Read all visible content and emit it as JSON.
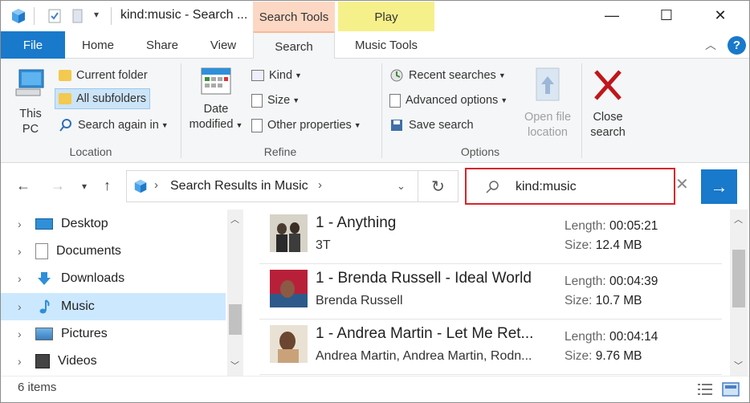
{
  "window": {
    "title": "kind:music - Search ...",
    "minimize": "—",
    "maximize": "☐",
    "close": "✕"
  },
  "context_tabs": {
    "search_tools": "Search Tools",
    "play": "Play"
  },
  "ribbon_tabs": {
    "file": "File",
    "home": "Home",
    "share": "Share",
    "view": "View",
    "search": "Search",
    "music_tools": "Music Tools"
  },
  "ribbon": {
    "location": {
      "label": "Location",
      "this_pc": [
        "This",
        "PC"
      ],
      "current_folder": "Current folder",
      "all_subfolders": "All subfolders",
      "search_again_in": "Search again in"
    },
    "refine": {
      "label": "Refine",
      "date_modified": [
        "Date",
        "modified"
      ],
      "kind": "Kind",
      "size": "Size",
      "other_properties": "Other properties"
    },
    "options": {
      "label": "Options",
      "recent_searches": "Recent searches",
      "advanced_options": "Advanced options",
      "save_search": "Save search",
      "open_file_location": [
        "Open file",
        "location"
      ],
      "close_search": [
        "Close",
        "search"
      ]
    }
  },
  "address": {
    "path": "Search Results in Music",
    "search_value": "kind:music"
  },
  "nav_pane": {
    "items": [
      {
        "label": "Desktop",
        "icon": "desktop-icon"
      },
      {
        "label": "Documents",
        "icon": "documents-icon"
      },
      {
        "label": "Downloads",
        "icon": "downloads-icon"
      },
      {
        "label": "Music",
        "icon": "music-icon"
      },
      {
        "label": "Pictures",
        "icon": "pictures-icon"
      },
      {
        "label": "Videos",
        "icon": "videos-icon"
      }
    ]
  },
  "results": [
    {
      "title": "1 - Anything",
      "artist": "3T",
      "length_label": "Length:",
      "length": "00:05:21",
      "size_label": "Size:",
      "size": "12.4 MB"
    },
    {
      "title": "1 - Brenda Russell - Ideal World",
      "artist": "Brenda Russell",
      "length_label": "Length:",
      "length": "00:04:39",
      "size_label": "Size:",
      "size": "10.7 MB"
    },
    {
      "title": "1 - Andrea Martin - Let Me Ret...",
      "artist": "Andrea Martin, Andrea Martin, Rodn...",
      "length_label": "Length:",
      "length": "00:04:14",
      "size_label": "Size:",
      "size": "9.76 MB"
    }
  ],
  "status": {
    "item_count": "6 items"
  },
  "colors": {
    "accent": "#1979ca",
    "search_tools_tab": "#fcd8c4",
    "play_tab": "#f6f08a",
    "search_highlight": "#d9242b",
    "selection": "#cce8ff"
  }
}
